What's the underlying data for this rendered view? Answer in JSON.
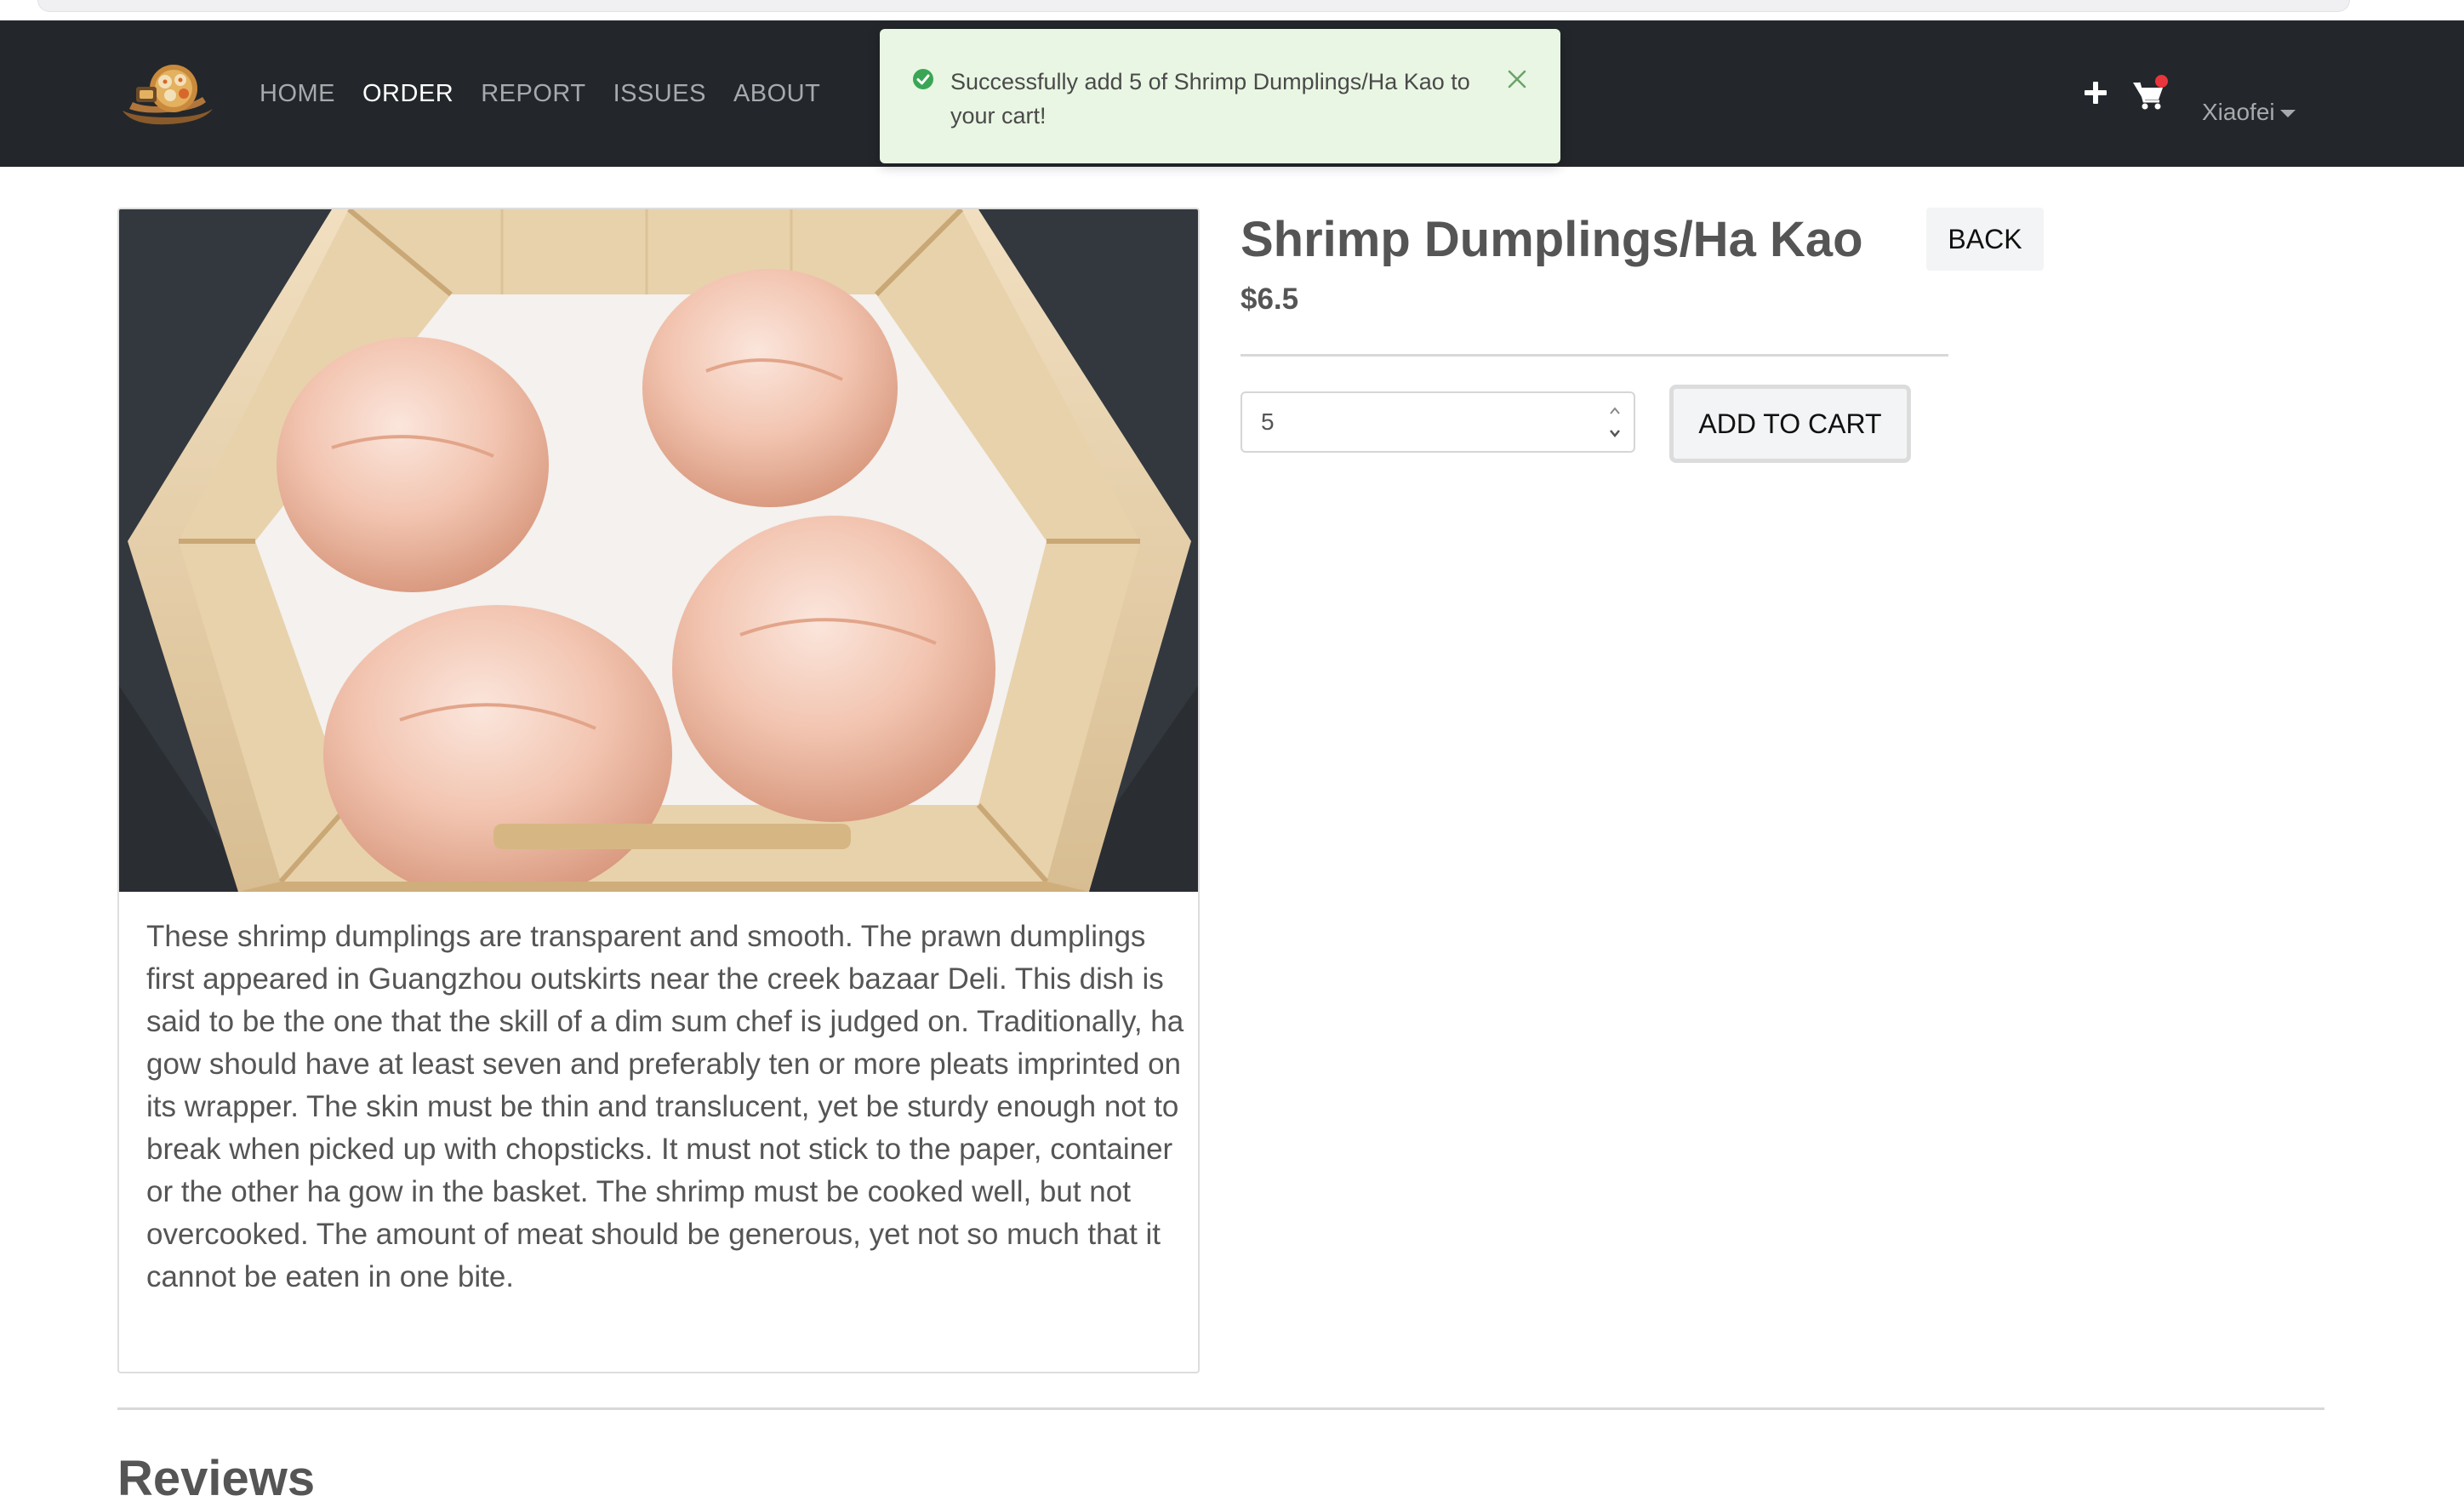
{
  "nav": {
    "logo_icon": "dim-sum-basket-logo",
    "links": [
      "HOME",
      "ORDER",
      "REPORT",
      "ISSUES",
      "ABOUT"
    ],
    "active_link": "ORDER",
    "add_icon": "plus-icon",
    "cart_icon": "shopping-cart-icon",
    "cart_has_items": true,
    "user_name": "Xiaofei",
    "colors": {
      "background": "#23272b",
      "link": "#a7aaad",
      "active_link": "#ffffff",
      "cart_badge": "#e8363c"
    }
  },
  "toast": {
    "icon": "check-circle-icon",
    "message": "Successfully add 5 of Shrimp Dumplings/Ha Kao to your cart!",
    "close_icon": "close-icon",
    "colors": {
      "background": "#e9f6e3",
      "icon": "#3aa655"
    }
  },
  "product": {
    "name": "Shrimp Dumplings/Ha Kao",
    "price": "$6.5",
    "image_alt": "Shrimp dumplings in a bamboo steamer",
    "description": "These shrimp dumplings are transparent and smooth. The prawn dumplings first appeared in Guangzhou outskirts near the creek bazaar Deli. This dish is said to be the one that the skill of a dim sum chef is judged on. Traditionally, ha gow should have at least seven and preferably ten or more pleats imprinted on its wrapper. The skin must be thin and translucent, yet be sturdy enough not to break when picked up with chopsticks. It must not stick to the paper, container or the other ha gow in the basket. The shrimp must be cooked well, but not overcooked. The amount of meat should be generous, yet not so much that it cannot be eaten in one bite."
  },
  "actions": {
    "back_label": "BACK",
    "quantity_value": "5",
    "add_to_cart_label": "ADD TO CART"
  },
  "reviews": {
    "heading": "Reviews"
  }
}
